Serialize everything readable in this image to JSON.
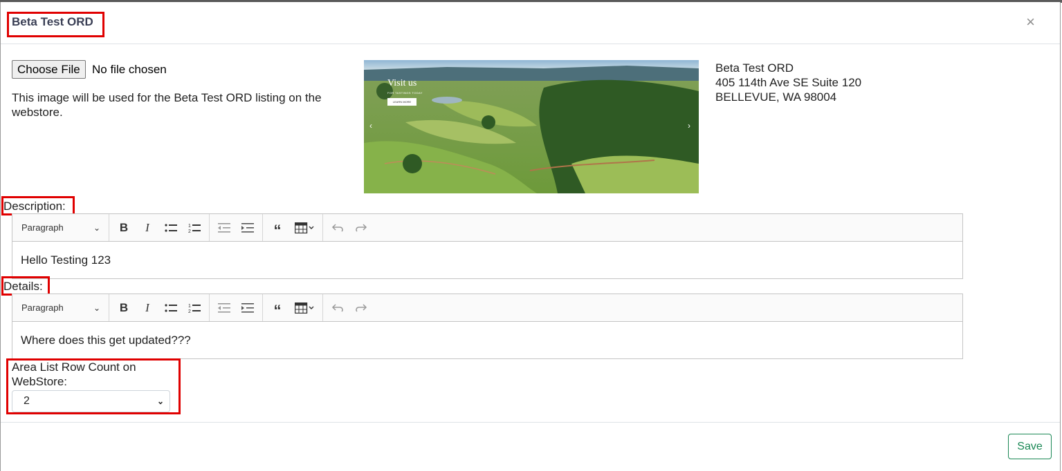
{
  "modal": {
    "title": "Beta Test ORD",
    "close_label": "×"
  },
  "image_upload": {
    "button_label": "Choose File",
    "status": "No file chosen",
    "help_text": "This image will be used for the Beta Test ORD listing on the webstore."
  },
  "hero_image": {
    "heading": "Visit us",
    "tagline": "FOR TASTINGS TODAY",
    "button_label": "LEARN MORE"
  },
  "address": {
    "line1": "Beta Test ORD",
    "line2": "405 114th Ave SE Suite 120",
    "line3": "BELLEVUE, WA 98004"
  },
  "description": {
    "label": "Description:",
    "heading_style": "Paragraph",
    "content": "Hello Testing 123"
  },
  "details": {
    "label": "Details:",
    "heading_style": "Paragraph",
    "content": "Where does this get updated???"
  },
  "row_count": {
    "label_line1": "Area List Row Count on",
    "label_line2": "WebStore:",
    "selected_value": "2"
  },
  "footer": {
    "save_label": "Save"
  },
  "colors": {
    "highlight": "#e00000",
    "save_accent": "#198754",
    "title_text": "#3a3f55"
  }
}
